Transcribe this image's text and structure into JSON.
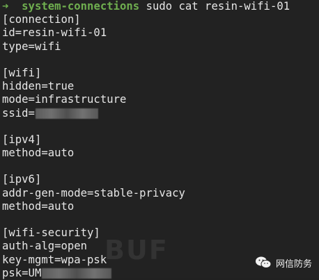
{
  "terminal": {
    "prompt": {
      "arrow": "➜",
      "directory": "system-connections",
      "command": "sudo cat resin-wifi-01"
    },
    "lines": [
      "[connection]",
      "id=resin-wifi-01",
      "type=wifi",
      "",
      "[wifi]",
      "hidden=true",
      "mode=infrastructure",
      "ssid=",
      "",
      "[ipv4]",
      "method=auto",
      "",
      "[ipv6]",
      "addr-gen-mode=stable-privacy",
      "method=auto",
      "",
      "[wifi-security]",
      "auth-alg=open",
      "key-mgmt=wpa-psk",
      "psk=UM"
    ]
  },
  "watermark": {
    "text": "BUF",
    "wechat_label": "网信防务",
    "icon": "wechat-icon"
  },
  "colors": {
    "background": "#222222",
    "text": "#e6e6e6",
    "prompt": "#6fae4f"
  }
}
